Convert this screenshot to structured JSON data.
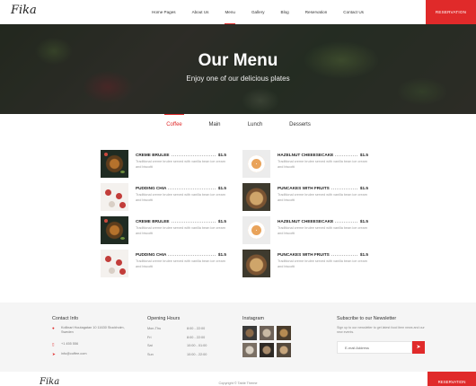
{
  "header": {
    "logo": "Fika",
    "nav": [
      "Home Pages",
      "About Us",
      "Menu",
      "Gallery",
      "Blog",
      "Reservation",
      "Contact Us"
    ],
    "active_nav": "Menu",
    "reservation_label": "RESERVATION"
  },
  "hero": {
    "title": "Our Menu",
    "subtitle": "Enjoy one of our delicious plates"
  },
  "tabs": [
    "Coffee",
    "Main",
    "Lunch",
    "Desserts"
  ],
  "active_tab": "Coffee",
  "menu": {
    "left": [
      {
        "name": "CREME BRULEE",
        "price": "$1.5",
        "desc": "Traditional creme brulee served with vanilla bean ice cream and biscotti",
        "thumb": "dark"
      },
      {
        "name": "PUDDING CHIA",
        "price": "$1.5",
        "desc": "Traditional creme brulee served with vanilla bean ice cream and biscotti",
        "thumb": "light"
      },
      {
        "name": "CREME BRULEE",
        "price": "$1.5",
        "desc": "Traditional creme brulee served with vanilla bean ice cream and biscotti",
        "thumb": "dark"
      },
      {
        "name": "PUDDING CHIA",
        "price": "$1.5",
        "desc": "Traditional creme brulee served with vanilla bean ice cream and biscotti",
        "thumb": "light"
      }
    ],
    "right": [
      {
        "name": "HAZELNUT CHEEESECAKE",
        "price": "$1.5",
        "desc": "Traditional creme brulee served with vanilla bean ice cream and biscotti",
        "thumb": "plate"
      },
      {
        "name": "PUNCAKES WITH FRUITS",
        "price": "$1.5",
        "desc": "Traditional creme brulee served with vanilla bean ice cream and biscotti",
        "thumb": "pancake"
      },
      {
        "name": "HAZELNUT CHEEESECAKE",
        "price": "$1.5",
        "desc": "Traditional creme brulee served with vanilla bean ice cream and biscotti",
        "thumb": "plate"
      },
      {
        "name": "PUNCAKES WITH FRUITS",
        "price": "$1.5",
        "desc": "Traditional creme brulee served with vanilla bean ice cream and biscotti",
        "thumb": "pancake"
      }
    ]
  },
  "footer": {
    "contact": {
      "title": "Contact Info",
      "address": "Kollinari Houtagatan 10 11630 Stockholm, Sweden",
      "phone": "+1 455 556",
      "email": "info@coffee.com"
    },
    "hours": {
      "title": "Opening Hours",
      "rows": [
        {
          "day": "Mon-Thu",
          "time": "8:00 - 22:00"
        },
        {
          "day": "Fri",
          "time": "8:00 - 22:00"
        },
        {
          "day": "Sat",
          "time": "10:00 - 01:00"
        },
        {
          "day": "Sun",
          "time": "10:00 - 22:00"
        }
      ]
    },
    "instagram": {
      "title": "Instagram"
    },
    "newsletter": {
      "title": "Subscribe to our Newsletter",
      "text": "Sign up to our newsletter to get latest food item news and our new events.",
      "placeholder": "E-mail Address"
    }
  },
  "bottom": {
    "logo": "Fika",
    "copyright": "Copyright © Table Theme",
    "reservation_label": "RESERVATION"
  },
  "colors": {
    "accent": "#e02a2a",
    "footer_bg": "#f5f5f5"
  }
}
